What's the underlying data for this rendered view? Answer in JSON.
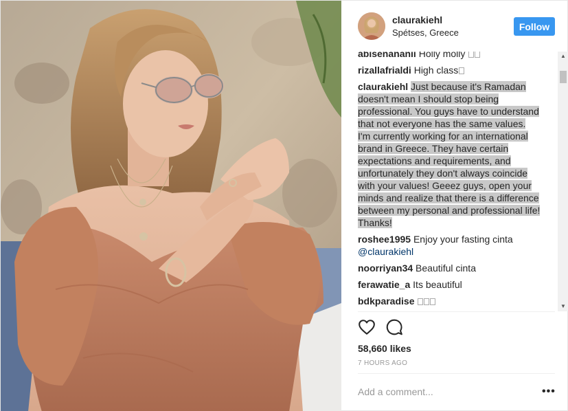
{
  "header": {
    "username": "claurakiehl",
    "location": "Spétses, Greece",
    "follow_label": "Follow"
  },
  "comments": [
    {
      "user": "abisenananii",
      "text": "Holly molly "
    },
    {
      "user": "rizallafrialdi",
      "text": "High class"
    },
    {
      "user": "claurakiehl",
      "text": "Just because it's Ramadan doesn't mean I should stop being professional. You guys have to understand that not everyone has the same values. I'm currently working for an international brand in Greece. They have certain expectations and requirements, and unfortunately they don't always coincide with your values! Geeez guys, open your minds and realize that there is a difference between my personal and professional life! Thanks!"
    },
    {
      "user": "roshee1995",
      "text": "Enjoy your fasting cinta ",
      "mention": "@claurakiehl"
    },
    {
      "user": "noorriyan34",
      "text": "Beautiful cinta"
    },
    {
      "user": "ferawatie_a",
      "text": "Its beautiful"
    },
    {
      "user": "bdkparadise",
      "text": " "
    }
  ],
  "actions": {
    "like_icon": "heart-icon",
    "comment_icon": "comment-bubble-icon"
  },
  "likes": "58,660 likes",
  "time": "7 HOURS AGO",
  "add_comment": {
    "placeholder": "Add a comment..."
  },
  "more_label": "•••",
  "colors": {
    "follow_bg": "#3897f0",
    "selection": "#c8c8c8",
    "muted": "#999999"
  }
}
